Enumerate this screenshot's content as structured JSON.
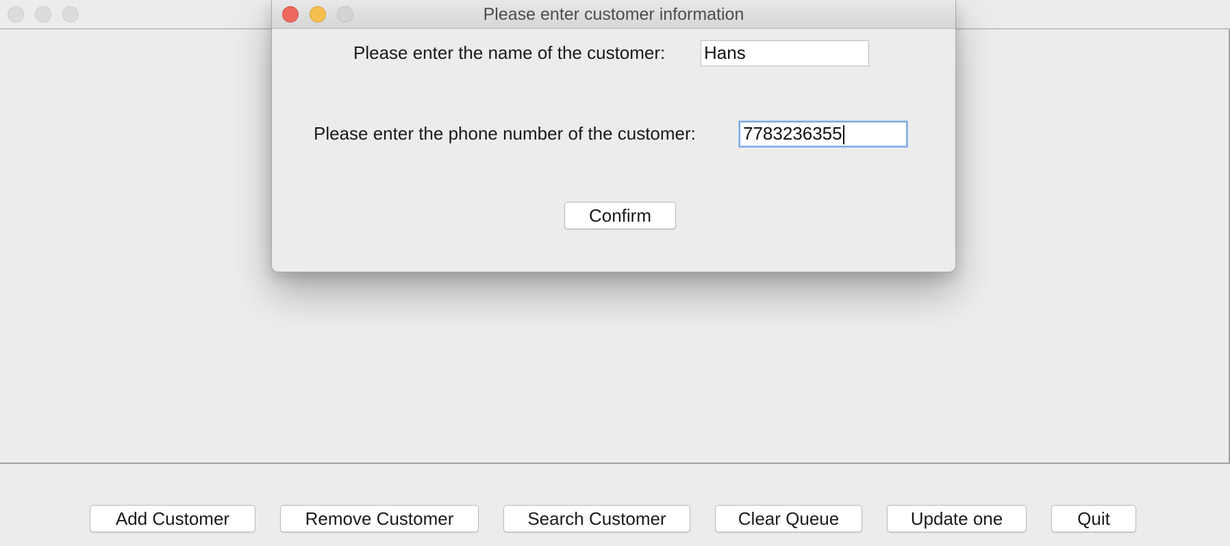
{
  "dialog": {
    "title": "Please enter customer information",
    "name_label": "Please enter the name of the customer:",
    "name_value": "Hans",
    "phone_label": "Please enter the phone number of the customer:",
    "phone_value": "7783236355",
    "confirm_label": "Confirm"
  },
  "toolbar": {
    "add_label": "Add Customer",
    "remove_label": "Remove Customer",
    "search_label": "Search Customer",
    "clear_label": "Clear Queue",
    "update_label": "Update one",
    "quit_label": "Quit"
  },
  "colors": {
    "close": "#ee6a5f",
    "minimize": "#f5be4f",
    "focus_ring": "#7fa9e2",
    "window_bg": "#ececec"
  }
}
